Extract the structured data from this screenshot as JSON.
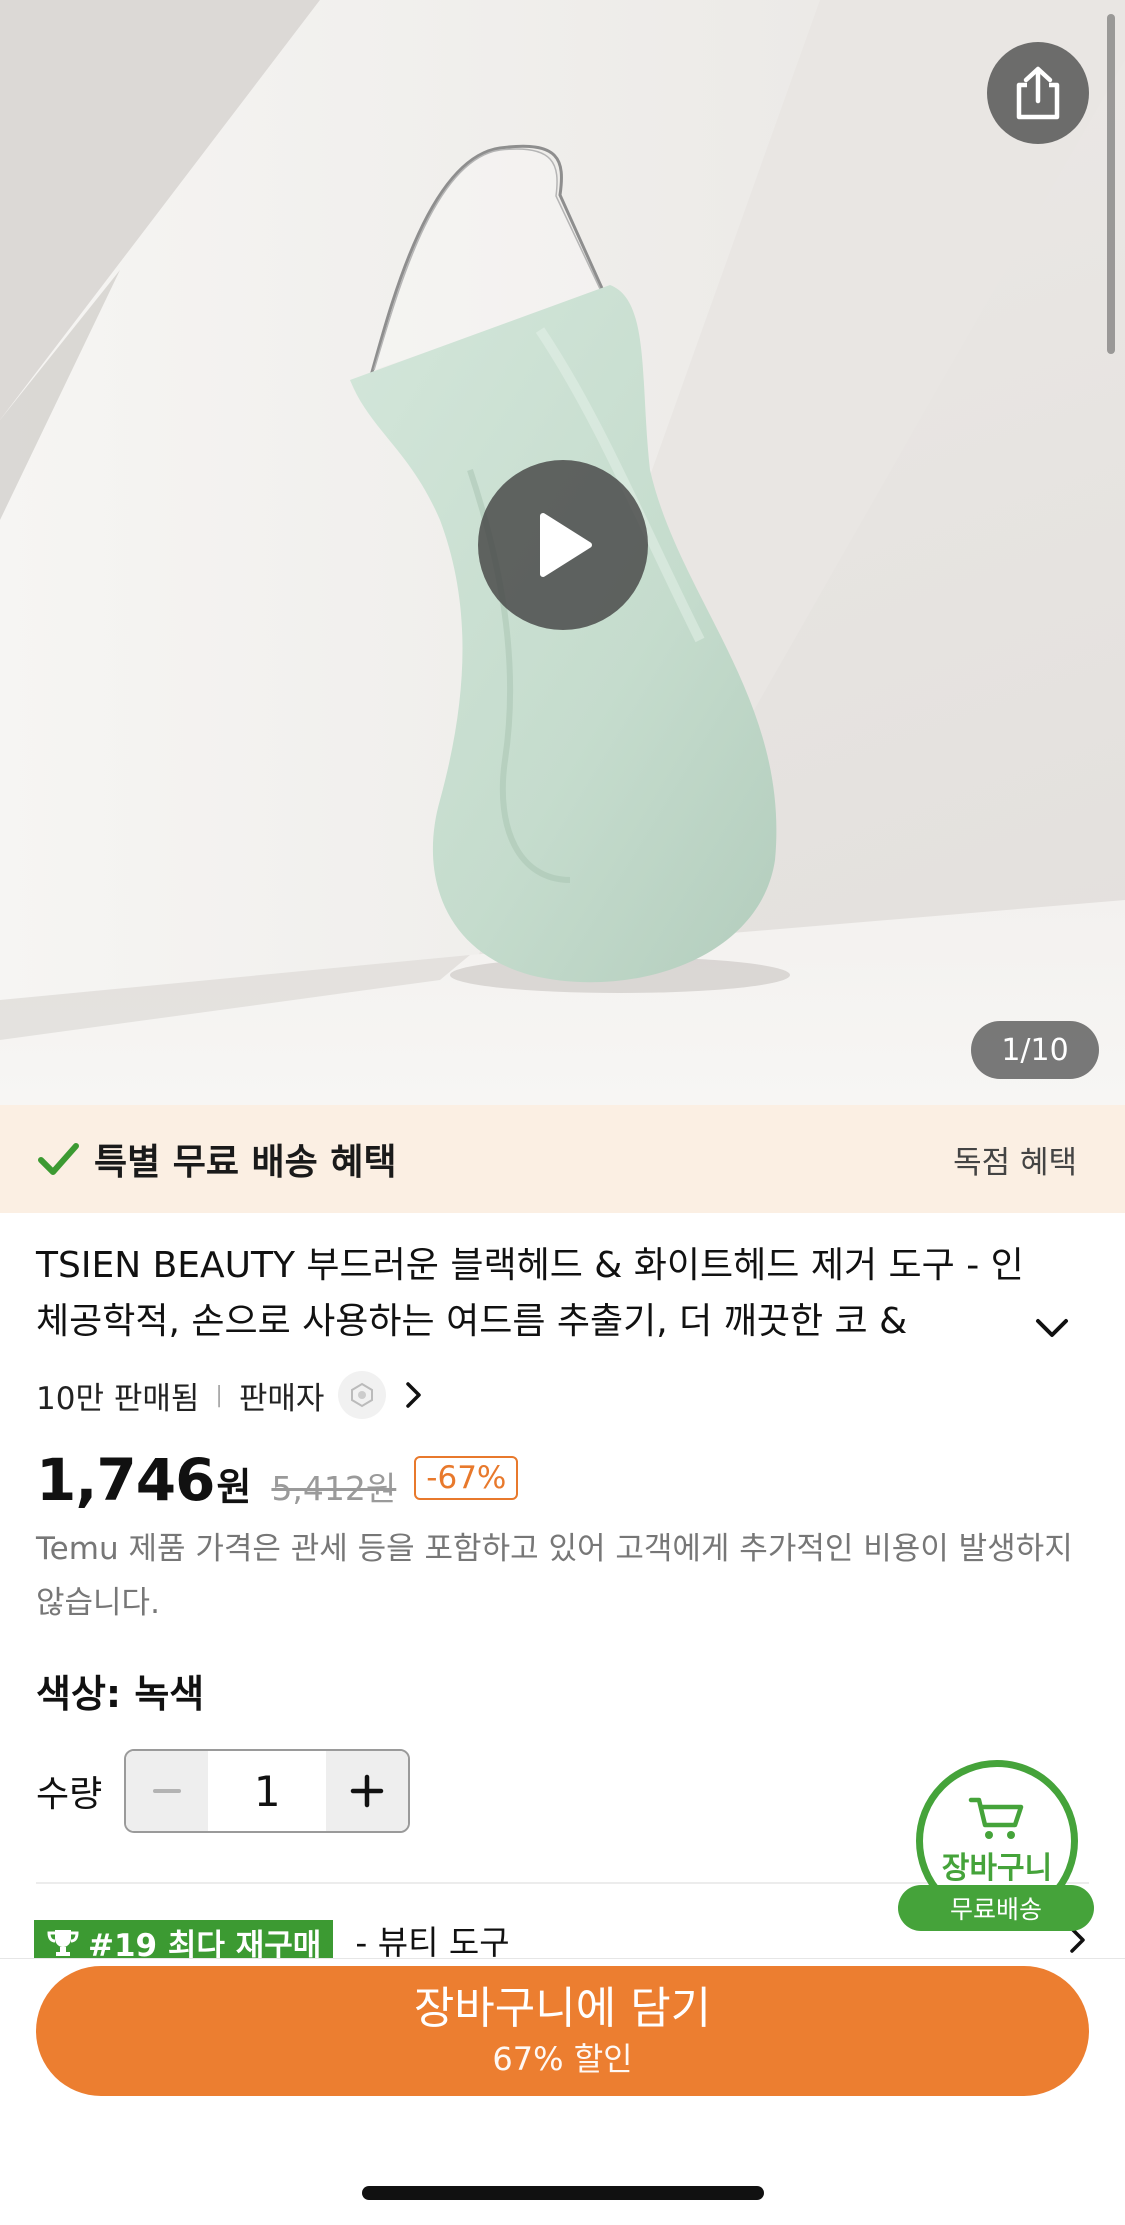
{
  "hero": {
    "image_counter": "1/10",
    "icons": {
      "share": "share-icon",
      "play": "play-icon"
    }
  },
  "shipping": {
    "text": "특별 무료 배송 혜택",
    "right_label": "독점 혜택",
    "accent": "#3c9a32"
  },
  "product": {
    "title": "TSIEN BEAUTY 부드러운 블랙헤드 & 화이트헤드 제거 도구 - 인체공학적, 손으로 사용하는 여드름 추출기, 더 깨끗한 코 &",
    "sold": "10만 판매됨",
    "seller_label": "판매자",
    "price": "1,746",
    "price_unit": "원",
    "original_price": "5,412원",
    "discount": "-67%",
    "price_note": "Temu 제품 가격은 관세 등을 포함하고 있어 고객에게 추가적인 비용이 발생하지 않습니다.",
    "color_option": "색상: 녹색",
    "quantity_label": "수량",
    "quantity": "1"
  },
  "rank": {
    "badge": "#19 최다 재구매",
    "category": "- 뷰티 도구"
  },
  "floating_cart": {
    "label": "장바구니",
    "pill": "무료배송"
  },
  "cta": {
    "main": "장바구니에 담기",
    "sub": "67% 할인",
    "color": "#ec7e30"
  },
  "colors": {
    "brand_orange": "#ec7e30",
    "green": "#45a33a",
    "banner_bg": "#fbefe3"
  }
}
